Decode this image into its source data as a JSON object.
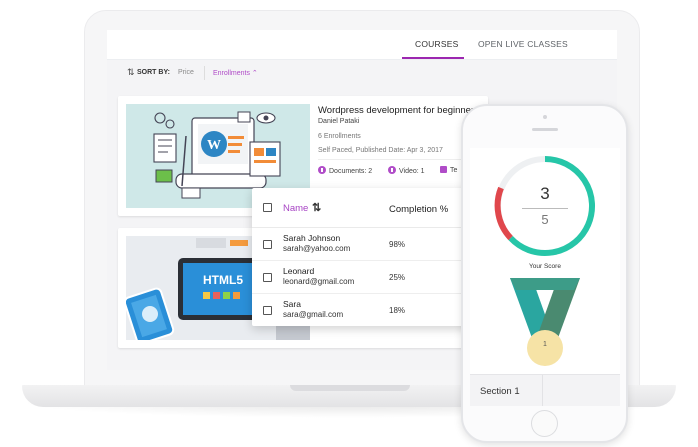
{
  "tabs": {
    "courses": "COURSES",
    "live": "OPEN LIVE CLASSES"
  },
  "sort": {
    "label": "SORT BY:",
    "price": "Price",
    "enrollments": "Enrollments"
  },
  "course1": {
    "title": "Wordpress development for beginners",
    "author": "Daniel Pataki",
    "enrollments": "6 Enrollments",
    "published": "Self Paced, Published Date: Apr 3, 2017",
    "documents": "Documents: 2",
    "video": "Video: 1",
    "third": "Te"
  },
  "course2": {
    "thumb_text": "HTML5"
  },
  "table": {
    "col_name": "Name",
    "col_completion": "Completion %",
    "rows": [
      {
        "name": "Sarah Johnson",
        "email": "sarah@yahoo.com",
        "completion": "98%"
      },
      {
        "name": "Leonard",
        "email": "leonard@gmail.com",
        "completion": "25%"
      },
      {
        "name": "Sara",
        "email": "sara@gmail.com",
        "completion": "18%"
      }
    ]
  },
  "phone": {
    "score_numerator": "3",
    "score_denominator": "5",
    "score_label": "Your Score",
    "medal_number": "1",
    "section_label": "Section 1"
  },
  "colors": {
    "accent": "#b04cc8",
    "ring_green": "#26c6a8",
    "ring_red": "#e0474c",
    "medal_teal": "#2aa6a0",
    "medal_green": "#4a8a70",
    "medal_gold": "#f6e3a6"
  }
}
